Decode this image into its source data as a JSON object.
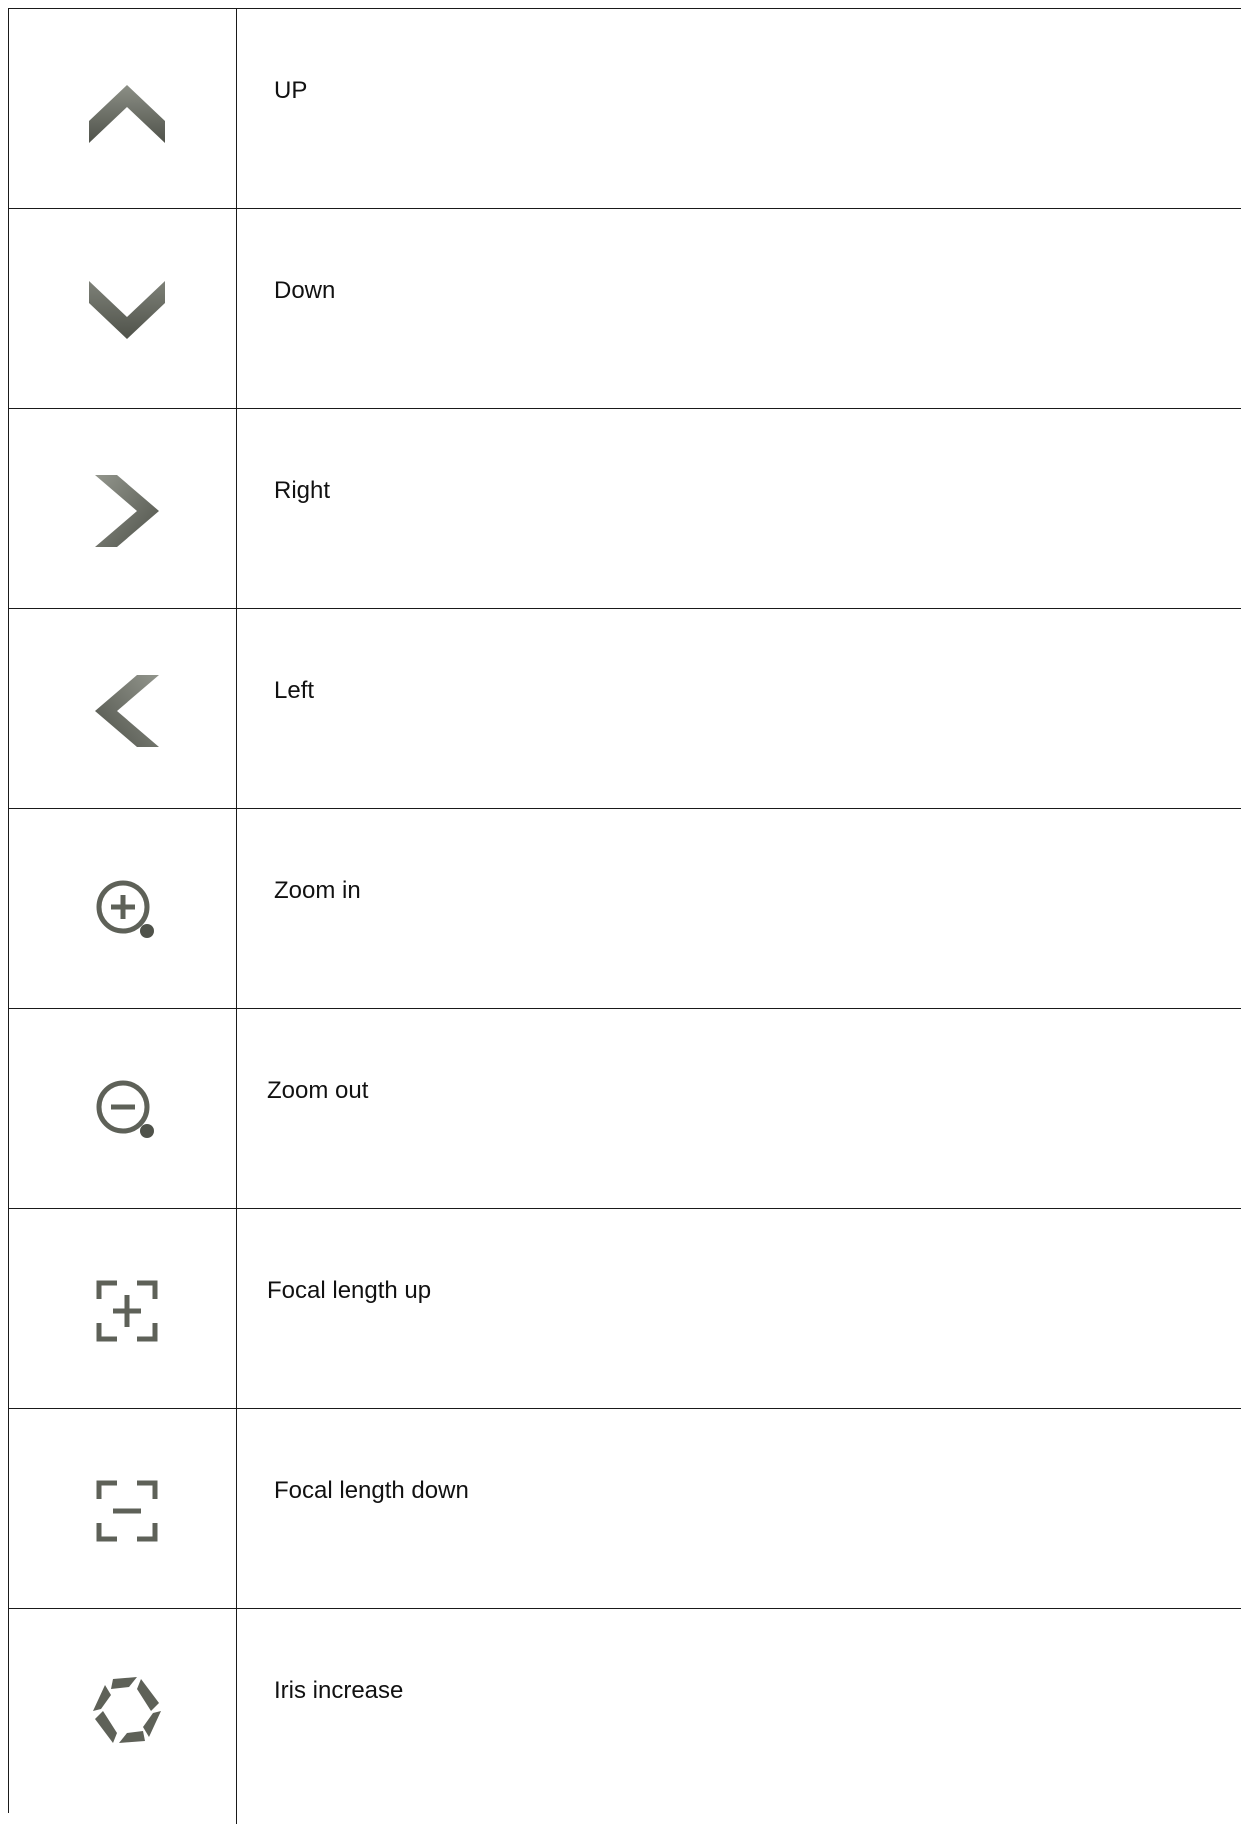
{
  "controls": [
    {
      "icon": "chevron-up-icon",
      "label": "UP"
    },
    {
      "icon": "chevron-down-icon",
      "label": "Down"
    },
    {
      "icon": "chevron-right-icon",
      "label": "Right"
    },
    {
      "icon": "chevron-left-icon",
      "label": "Left"
    },
    {
      "icon": "zoom-in-icon",
      "label": "Zoom in"
    },
    {
      "icon": "zoom-out-icon",
      "label": "Zoom out"
    },
    {
      "icon": "focus-plus-icon",
      "label": "Focal length up"
    },
    {
      "icon": "focus-minus-icon",
      "label": "Focal length down"
    },
    {
      "icon": "iris-icon",
      "label": "Iris increase"
    }
  ],
  "icon_color": "#5e6158"
}
